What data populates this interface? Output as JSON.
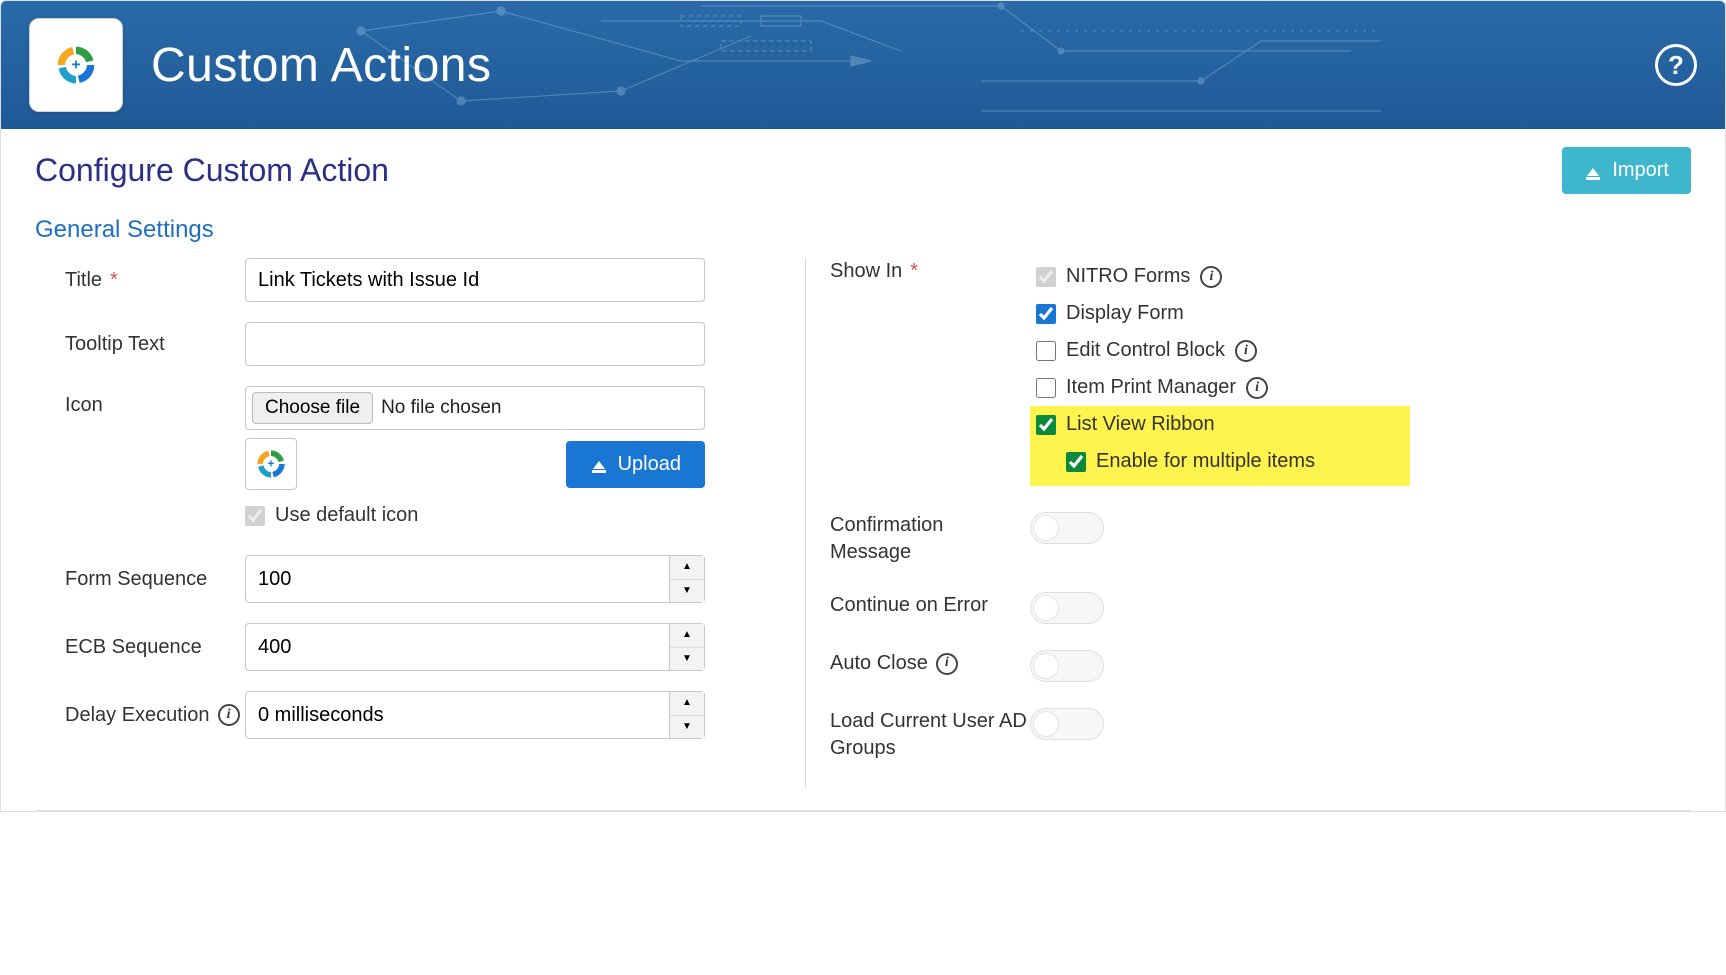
{
  "header": {
    "title": "Custom Actions",
    "help_label": "?"
  },
  "page_title": "Configure Custom Action",
  "import_label": "Import",
  "section_general": "General Settings",
  "left": {
    "title_label": "Title",
    "title_value": "Link Tickets with Issue Id",
    "tooltip_label": "Tooltip Text",
    "tooltip_value": "",
    "icon_label": "Icon",
    "choose_file_label": "Choose file",
    "no_file_label": "No file chosen",
    "upload_label": "Upload",
    "use_default_icon_label": "Use default icon",
    "form_seq_label": "Form Sequence",
    "form_seq_value": "100",
    "ecb_seq_label": "ECB Sequence",
    "ecb_seq_value": "400",
    "delay_label": "Delay Execution",
    "delay_value": "0 milliseconds"
  },
  "right": {
    "show_in_label": "Show In",
    "nitro_forms_label": "NITRO Forms",
    "display_form_label": "Display Form",
    "edit_control_label": "Edit Control Block",
    "item_print_label": "Item Print Manager",
    "list_view_label": "List View Ribbon",
    "enable_multi_label": "Enable for multiple items",
    "confirm_label": "Confirmation Message",
    "continue_label": "Continue on Error",
    "autoclose_label": "Auto Close",
    "adgroups_label": "Load Current User AD Groups"
  }
}
